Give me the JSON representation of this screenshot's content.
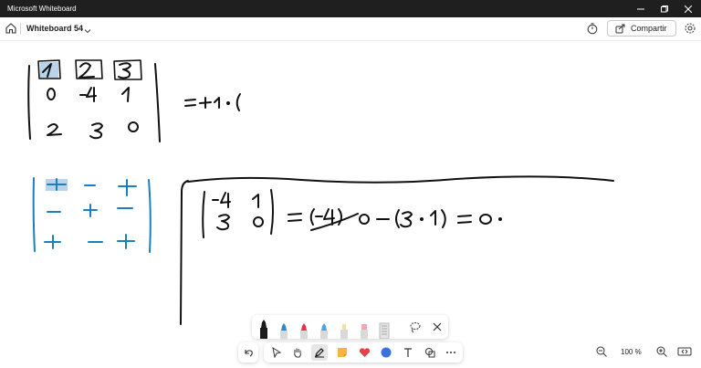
{
  "window": {
    "title": "Microsoft Whiteboard",
    "controls": [
      "minimize",
      "restore",
      "close"
    ]
  },
  "appbar": {
    "board_title": "Whiteboard 54",
    "share_label": "Compartir",
    "icons": [
      "home-icon",
      "chevron-down-icon",
      "timer-icon",
      "share-icon",
      "settings-icon"
    ]
  },
  "canvas": {
    "ink_colors": {
      "black": "#111111",
      "blue": "#1c7fc0",
      "highlight": "#b9d3ea"
    }
  },
  "toolbar": {
    "pens": [
      {
        "name": "pen-black",
        "color": "#1a1a1a"
      },
      {
        "name": "pen-blue",
        "color": "#2f86c8"
      },
      {
        "name": "pen-red",
        "color": "#e0334a"
      },
      {
        "name": "pen-lightblue",
        "color": "#4aa3df"
      },
      {
        "name": "highlighter-cream",
        "color": "#f3e0a0"
      },
      {
        "name": "highlighter-pink",
        "color": "#f4a7b3"
      }
    ],
    "tools": [
      "undo",
      "select",
      "pan",
      "pen",
      "sticky-note",
      "reactions",
      "shapes",
      "text",
      "insert-shape",
      "more"
    ]
  },
  "zoom": {
    "label": "100 %"
  }
}
